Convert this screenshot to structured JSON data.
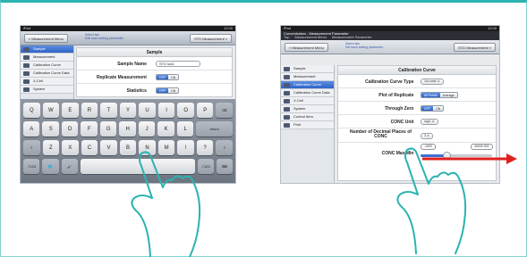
{
  "colors": {
    "frame_accent": "#2bb3b1",
    "active_blue": "#2f64c8",
    "arrow_red": "#e0201e"
  },
  "left": {
    "status": {
      "carrier": "iPad",
      "time": "12:00"
    },
    "nav": {
      "back_label": "« Measurement Menu",
      "note_line1": "Select tab.",
      "note_line2": "Edit each setting parameter.",
      "right_label": "STD Measurement »"
    },
    "sidebar": [
      {
        "label": "Sample",
        "active": true
      },
      {
        "label": "Measurement",
        "active": false
      },
      {
        "label": "Calibration Curve",
        "active": false
      },
      {
        "label": "Calibration Curve Data",
        "active": false
      },
      {
        "label": "X-Cell",
        "active": false
      },
      {
        "label": "System",
        "active": false
      }
    ],
    "panel": {
      "title": "Sample",
      "sample_name_label": "Sample Name",
      "sample_name_value": "STD tab1",
      "replicate_label": "Replicate Measurement",
      "statistics_label": "Statistics",
      "toggle_off": "OFF",
      "toggle_on": "ON"
    },
    "keyboard": {
      "row1": [
        "Q",
        "W",
        "E",
        "R",
        "T",
        "Y",
        "U",
        "I",
        "O",
        "P",
        "⌫"
      ],
      "row2": [
        "A",
        "S",
        "D",
        "F",
        "G",
        "H",
        "J",
        "K",
        "L",
        "return"
      ],
      "row3": [
        "⇧",
        "Z",
        "X",
        "C",
        "V",
        "B",
        "N",
        "M",
        "!",
        "?",
        "⇧"
      ],
      "row4": [
        ".?123",
        "🌐",
        "🎤",
        "",
        ".?123",
        "⌨"
      ]
    }
  },
  "right": {
    "status": {
      "carrier": "iPad",
      "time": "12:00"
    },
    "titlebar": {
      "title": "Concentration - Measurement Parameter",
      "tabs": [
        "Top",
        "Measurement Menu",
        "Measurement Parameter"
      ]
    },
    "nav": {
      "back_label": "« Measurement Menu",
      "note_line1": "Select tab.",
      "note_line2": "Set each setting parameter.",
      "right_label": "STD Measurement »"
    },
    "sidebar": [
      {
        "label": "Sample",
        "active": false
      },
      {
        "label": "Measurement",
        "active": false
      },
      {
        "label": "Calibration Curve",
        "active": true
      },
      {
        "label": "Calibration Curve Data",
        "active": false
      },
      {
        "label": "X-Cell",
        "active": false
      },
      {
        "label": "System",
        "active": false
      },
      {
        "label": "Control Item",
        "active": false
      },
      {
        "label": "Print",
        "active": false
      }
    ],
    "panel": {
      "title": "Calibration Curve",
      "curve_type_label": "Calibration Curve Type",
      "curve_type_value": "1st order",
      "plot_label": "Plot of Replicate",
      "plot_all": "All Points",
      "plot_avg": "Average",
      "zero_label": "Through Zero",
      "zero_off": "OFF",
      "zero_on": "ON",
      "unit_label": "CONC Unit",
      "unit_value": "mg/L",
      "decimal_label": "Number of Decimal Places of CONC",
      "decimal_value": "3",
      "maxmin_label": "CONC Max/Min",
      "min_value": "-1000",
      "max_value": "40000.000"
    }
  }
}
